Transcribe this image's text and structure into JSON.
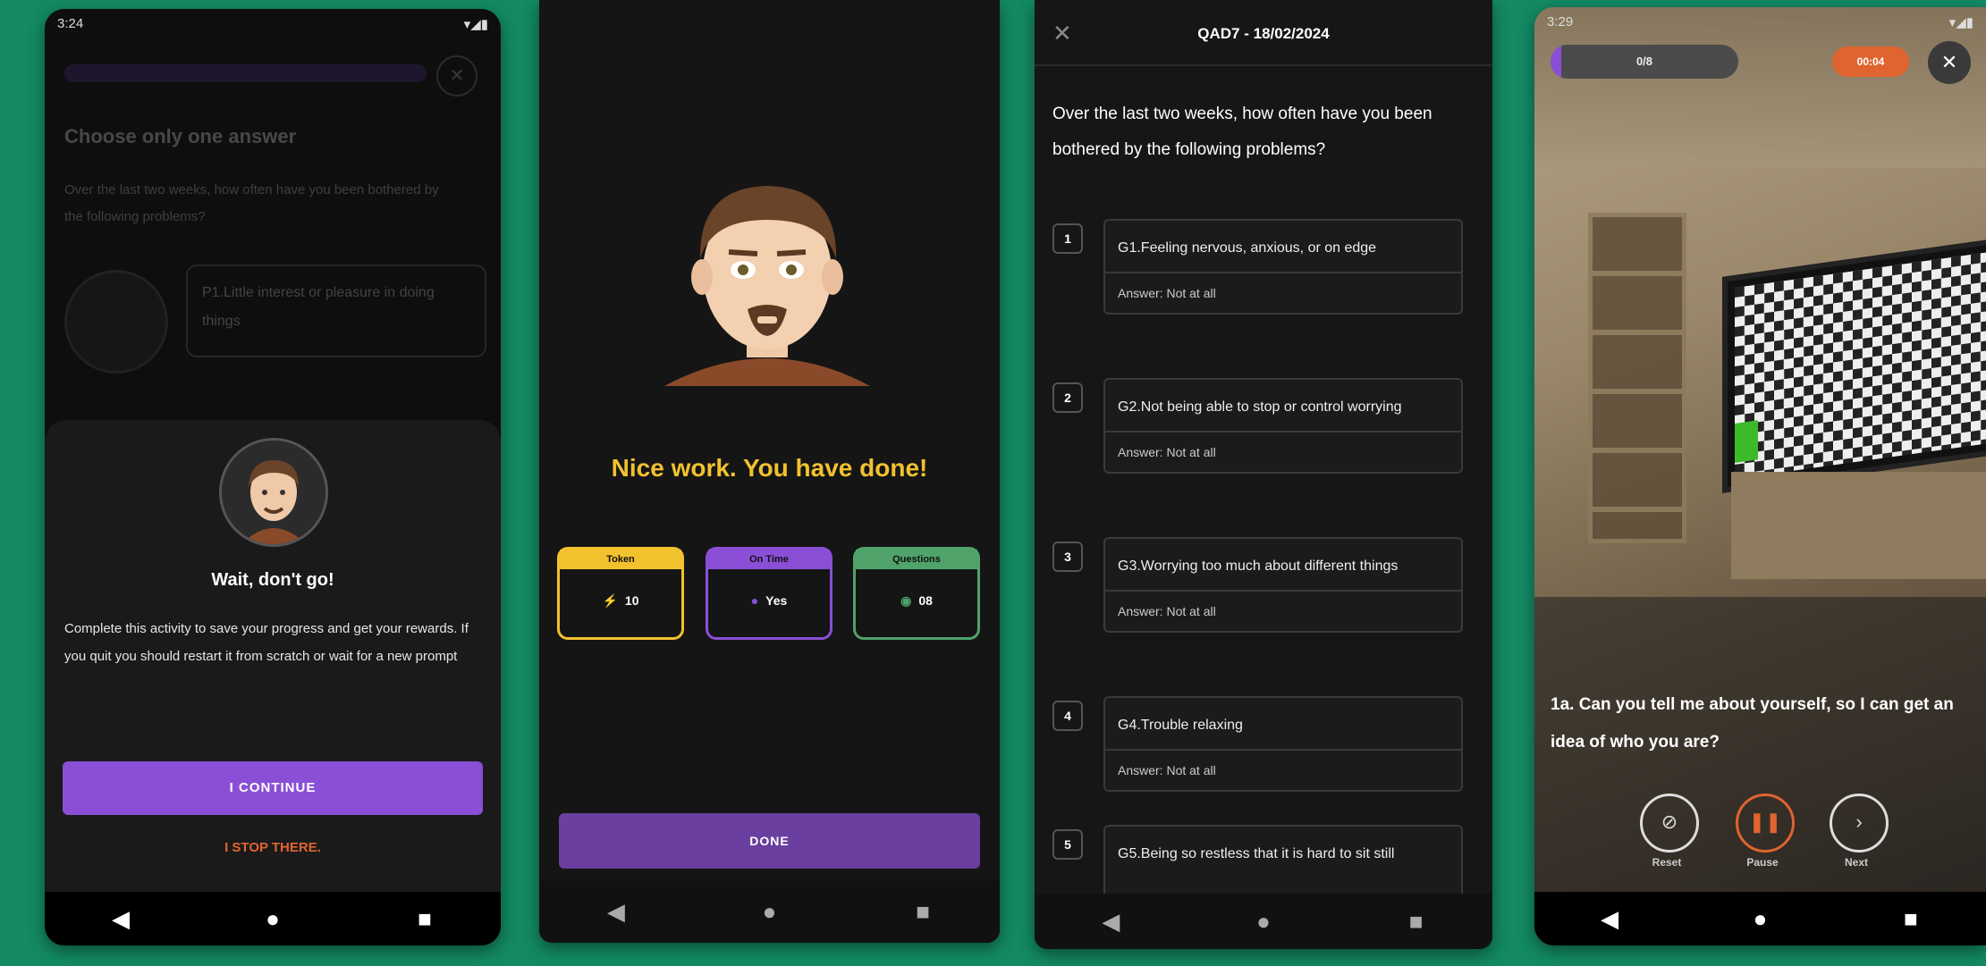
{
  "phone1": {
    "status_time": "3:24",
    "title": "Choose only one answer",
    "question": "Over the last two weeks, how often have you been bothered by the following problems?",
    "bubble": "P1.Little interest or pleasure in doing things",
    "sheet_title": "Wait, don't go!",
    "sheet_body": "Complete this activity to save your progress and get your rewards. If you quit you should restart it from scratch or wait for a new prompt",
    "continue_label": "I CONTINUE",
    "stop_label": "I STOP THERE."
  },
  "phone2": {
    "headline": "Nice work. You have done!",
    "stats": [
      {
        "title": "Token",
        "value": "10",
        "color": "#f2c12e"
      },
      {
        "title": "On Time",
        "value": "Yes",
        "color": "#8a4fd6"
      },
      {
        "title": "Questions",
        "value": "08",
        "color": "#4fa36b"
      }
    ],
    "done_label": "DONE"
  },
  "phone3": {
    "title": "QAD7 - 18/02/2024",
    "prompt": "Over the last two weeks, how often have you been bothered by the following problems?",
    "items": [
      {
        "num": "1",
        "text": "G1.Feeling nervous, anxious, or on edge",
        "answer": "Answer: Not at all"
      },
      {
        "num": "2",
        "text": "G2.Not being able to stop or control worrying",
        "answer": "Answer: Not at all"
      },
      {
        "num": "3",
        "text": "G3.Worrying too much about different things",
        "answer": "Answer: Not at all"
      },
      {
        "num": "4",
        "text": "G4.Trouble relaxing",
        "answer": "Answer: Not at all"
      },
      {
        "num": "5",
        "text": "G5.Being so restless that it is hard to sit still",
        "answer": ""
      }
    ]
  },
  "phone4": {
    "status_time": "3:29",
    "progress": "0/8",
    "progress_fraction": 0.02,
    "timer": "00:04",
    "question": "1a. Can you tell me about yourself, so I can get an idea of who you are?",
    "reset_label": "Reset",
    "pause_label": "Pause",
    "next_label": "Next"
  },
  "colors": {
    "purple": "#8a4fd6",
    "yellow": "#f2c12e",
    "green": "#4fa36b",
    "orange": "#e0642f",
    "bg": "#138a63"
  }
}
